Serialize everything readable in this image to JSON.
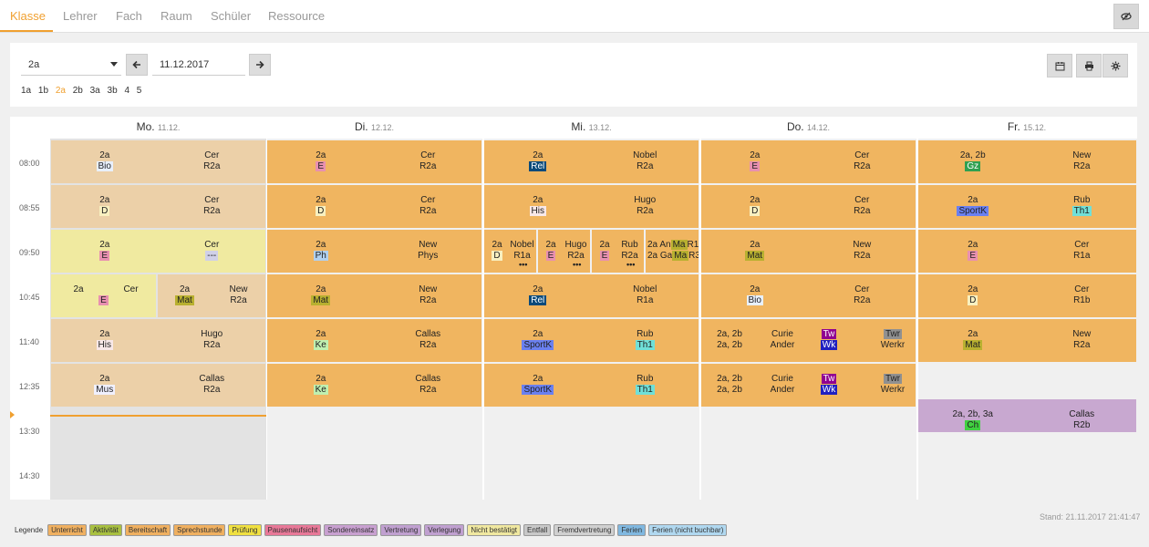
{
  "tabs": [
    "Klasse",
    "Lehrer",
    "Fach",
    "Raum",
    "Schüler",
    "Ressource"
  ],
  "active_tab": "Klasse",
  "controls": {
    "class_value": "2a",
    "date_value": "11.12.2017",
    "class_links": [
      "1a",
      "1b",
      "2a",
      "2b",
      "3a",
      "3b",
      "4",
      "5"
    ],
    "active_class": "2a"
  },
  "days": [
    {
      "name": "Mo.",
      "date": "11.12."
    },
    {
      "name": "Di.",
      "date": "12.12."
    },
    {
      "name": "Mi.",
      "date": "13.12."
    },
    {
      "name": "Do.",
      "date": "14.12."
    },
    {
      "name": "Fr.",
      "date": "15.12."
    }
  ],
  "times": [
    "08:00",
    "08:55",
    "09:50",
    "10:45",
    "11:40",
    "12:35",
    "13:30",
    "14:30"
  ],
  "lessons": {
    "mo": [
      {
        "cls": "2a",
        "sub": "Bio",
        "teacher": "Cer",
        "room": "R2a"
      },
      {
        "cls": "2a",
        "sub": "D",
        "teacher": "Cer",
        "room": "R2a"
      },
      {
        "cls": "2a",
        "sub": "E",
        "teacher": "Cer",
        "room": "---"
      },
      {
        "cls": "2a",
        "sub": "E",
        "teacher": "Cer",
        "room": ""
      },
      {
        "cls": "2a",
        "sub": "Mat",
        "teacher": "New",
        "room": "R2a"
      },
      {
        "cls": "2a",
        "sub": "His",
        "teacher": "Hugo",
        "room": "R2a"
      },
      {
        "cls": "2a",
        "sub": "Mus",
        "teacher": "Callas",
        "room": "R2a"
      }
    ],
    "di": [
      {
        "cls": "2a",
        "sub": "E",
        "teacher": "Cer",
        "room": "R2a"
      },
      {
        "cls": "2a",
        "sub": "D",
        "teacher": "Cer",
        "room": "R2a"
      },
      {
        "cls": "2a",
        "sub": "Ph",
        "teacher": "New",
        "room": "Phys"
      },
      {
        "cls": "2a",
        "sub": "Mat",
        "teacher": "New",
        "room": "R2a"
      },
      {
        "cls": "2a",
        "sub": "Ke",
        "teacher": "Callas",
        "room": "R2a"
      },
      {
        "cls": "2a",
        "sub": "Ke",
        "teacher": "Callas",
        "room": "R2a"
      }
    ],
    "mi": [
      {
        "cls": "2a",
        "sub": "Rel",
        "teacher": "Nobel",
        "room": "R2a"
      },
      {
        "cls": "2a",
        "sub": "His",
        "teacher": "Hugo",
        "room": "R2a"
      },
      {
        "cls": "2a",
        "sub": "Rel",
        "teacher": "Nobel",
        "room": "R1a"
      },
      {
        "cls": "2a",
        "sub": "SportK",
        "teacher": "Rub",
        "room": "Th1"
      },
      {
        "cls": "2a",
        "sub": "SportK",
        "teacher": "Rub",
        "room": "Th1"
      }
    ],
    "mi_split": [
      {
        "cls": "2a",
        "sub": "D",
        "teacher": "Nobel",
        "room": "R1a"
      },
      {
        "cls": "2a",
        "sub": "E",
        "teacher": "Hugo",
        "room": "R2a"
      },
      {
        "cls": "2a",
        "sub": "E",
        "teacher": "Rub",
        "room": "R2a"
      },
      {
        "line1": "2a An",
        "line1b": "Ma",
        "line1c": "R1b",
        "line2": "2a Ga",
        "line2b": "Ma",
        "line2c": "R3"
      }
    ],
    "do": [
      {
        "cls": "2a",
        "sub": "E",
        "teacher": "Cer",
        "room": "R2a"
      },
      {
        "cls": "2a",
        "sub": "D",
        "teacher": "Cer",
        "room": "R2a"
      },
      {
        "cls": "2a",
        "sub": "Mat",
        "teacher": "New",
        "room": "R2a"
      },
      {
        "cls": "2a",
        "sub": "Bio",
        "teacher": "Cer",
        "room": "R2a"
      },
      {
        "cls1": "2a, 2b",
        "cls2": "2a, 2b",
        "t1": "Curie",
        "t2": "Ander",
        "s1": "Tw",
        "s2": "Wk",
        "r1": "Twr",
        "r2": "Werkr"
      },
      {
        "cls1": "2a, 2b",
        "cls2": "2a, 2b",
        "t1": "Curie",
        "t2": "Ander",
        "s1": "Tw",
        "s2": "Wk",
        "r1": "Twr",
        "r2": "Werkr"
      }
    ],
    "fr": [
      {
        "cls": "2a, 2b",
        "sub": "Gz",
        "teacher": "New",
        "room": "R2a"
      },
      {
        "cls": "2a",
        "sub": "SportK",
        "teacher": "Rub",
        "room": "Th1"
      },
      {
        "cls": "2a",
        "sub": "E",
        "teacher": "Cer",
        "room": "R1a"
      },
      {
        "cls": "2a",
        "sub": "D",
        "teacher": "Cer",
        "room": "R1b"
      },
      {
        "cls": "2a",
        "sub": "Mat",
        "teacher": "New",
        "room": "R2a"
      },
      {
        "cls": "2a, 2b, 3a",
        "sub": "Ch",
        "teacher": "Callas",
        "room": "R2b"
      }
    ]
  },
  "stand": "Stand: 21.11.2017 21:41:47",
  "legend_label": "Legende",
  "legend": [
    {
      "label": "Unterricht",
      "color": "#f0b060"
    },
    {
      "label": "Aktivität",
      "color": "#a8c040"
    },
    {
      "label": "Bereitschaft",
      "color": "#f0b060"
    },
    {
      "label": "Sprechstunde",
      "color": "#f0b060"
    },
    {
      "label": "Prüfung",
      "color": "#f0e040"
    },
    {
      "label": "Pausenaufsicht",
      "color": "#e87898"
    },
    {
      "label": "Sondereinsatz",
      "color": "#c8a0d0"
    },
    {
      "label": "Vertretung",
      "color": "#c0a0d0"
    },
    {
      "label": "Verlegung",
      "color": "#c0a0d0"
    },
    {
      "label": "Nicht bestätigt",
      "color": "#f0e8a0"
    },
    {
      "label": "Entfall",
      "color": "#c8c8c8"
    },
    {
      "label": "Fremdvertretung",
      "color": "#d0d0d0"
    },
    {
      "label": "Ferien",
      "color": "#80b8e0"
    },
    {
      "label": "Ferien (nicht buchbar)",
      "color": "#b0d8f0"
    }
  ],
  "colors": {
    "accent": "#f0a030",
    "lesson": "#f0b560",
    "lesson_mo": "#ecd0a8",
    "pending": "#f0eaa0",
    "special": "#c8a8d0"
  }
}
